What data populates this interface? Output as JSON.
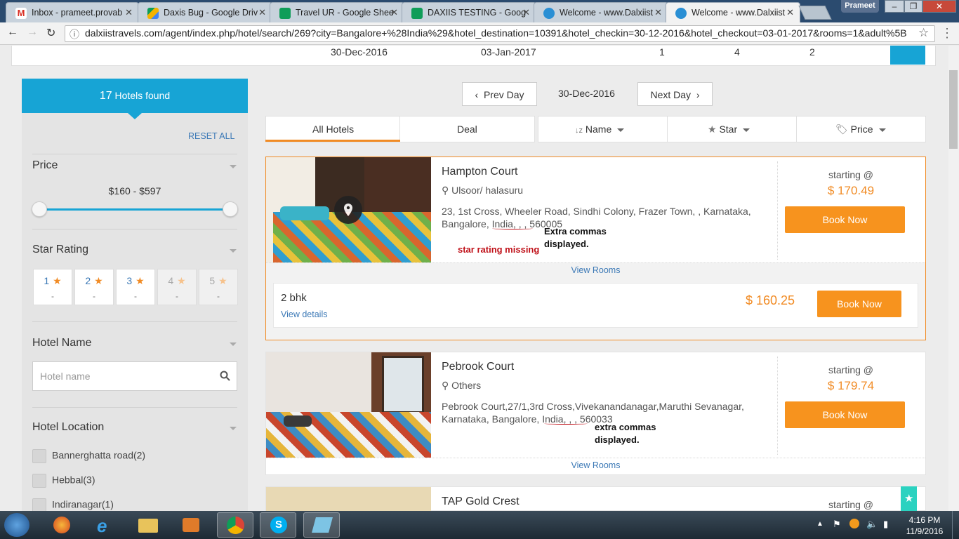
{
  "browser": {
    "tabs": [
      {
        "title": "Inbox - prameet.provab",
        "icon": "gmail-icon",
        "color": "#d93025"
      },
      {
        "title": "Daxis Bug - Google Driv",
        "icon": "drive-icon",
        "color": "#f4b400"
      },
      {
        "title": "Travel UR - Google Shee",
        "icon": "sheets-icon",
        "color": "#0f9d58"
      },
      {
        "title": "DAXIIS TESTING - Goog",
        "icon": "sheets-icon",
        "color": "#0f9d58"
      },
      {
        "title": "Welcome - www.Dalxiist",
        "icon": "site-icon",
        "color": "#2a8fd4"
      },
      {
        "title": "Welcome - www.Dalxiist",
        "icon": "site-icon",
        "color": "#2a8fd4"
      }
    ],
    "profile": "Prameet",
    "url": "dalxiistravels.com/agent/index.php/hotel/search/269?city=Bangalore+%28India%29&hotel_destination=10391&hotel_checkin=30-12-2016&hotel_checkout=03-01-2017&rooms=1&adult%5B"
  },
  "summary": {
    "checkin": "30-Dec-2016",
    "checkout": "03-Jan-2017",
    "rooms": "1",
    "adults": "4",
    "children": "2"
  },
  "sidebar": {
    "found_count": "17",
    "found_text": "Hotels found",
    "reset": "RESET ALL",
    "price_title": "Price",
    "price_range": "$160 - $597",
    "star_title": "Star Rating",
    "stars": [
      {
        "n": "1",
        "count": "-"
      },
      {
        "n": "2",
        "count": "-"
      },
      {
        "n": "3",
        "count": "-"
      },
      {
        "n": "4",
        "count": "-"
      },
      {
        "n": "5",
        "count": "-"
      }
    ],
    "hotel_name_title": "Hotel Name",
    "hotel_name_placeholder": "Hotel name",
    "location_title": "Hotel Location",
    "locations": [
      "Bannerghatta road(2)",
      "Hebbal(3)",
      "Indiranagar(1)"
    ]
  },
  "daynav": {
    "prev": "Prev Day",
    "current": "30-Dec-2016",
    "next": "Next Day"
  },
  "tabs": {
    "all": "All Hotels",
    "deal": "Deal"
  },
  "sort": {
    "name": "Name",
    "star": "Star",
    "price": "Price"
  },
  "hotels": [
    {
      "name": "Hampton Court",
      "area": "Ulsoor/ halasuru",
      "address1": "23, 1st Cross, Wheeler Road, Sindhi Colony, Frazer Town, , Karnataka,",
      "address2": "Bangalore, India, , , 560005",
      "starting": "starting @",
      "price": "$  170.49",
      "book": "Book Now",
      "view_rooms": "View Rooms",
      "room": {
        "name": "2 bhk",
        "details": "View details",
        "price": "$  160.25",
        "book": "Book Now"
      }
    },
    {
      "name": "Pebrook Court",
      "area": "Others",
      "address1": "Pebrook Court,27/1,3rd Cross,Vivekanandanagar,Maruthi Sevanagar,",
      "address2": "Karnataka, Bangalore, India, , , 560033",
      "starting": "starting @",
      "price": "$  179.74",
      "book": "Book Now",
      "view_rooms": "View Rooms"
    },
    {
      "name": "TAP Gold Crest",
      "starting": "starting @"
    }
  ],
  "annotations": {
    "a1_line1": "Extra commas",
    "a1_line2": "displayed.",
    "a2": "star rating missing",
    "a3_line1": "extra commas",
    "a3_line2": "displayed."
  },
  "taskbar": {
    "time": "4:16 PM",
    "date": "11/9/2016"
  }
}
